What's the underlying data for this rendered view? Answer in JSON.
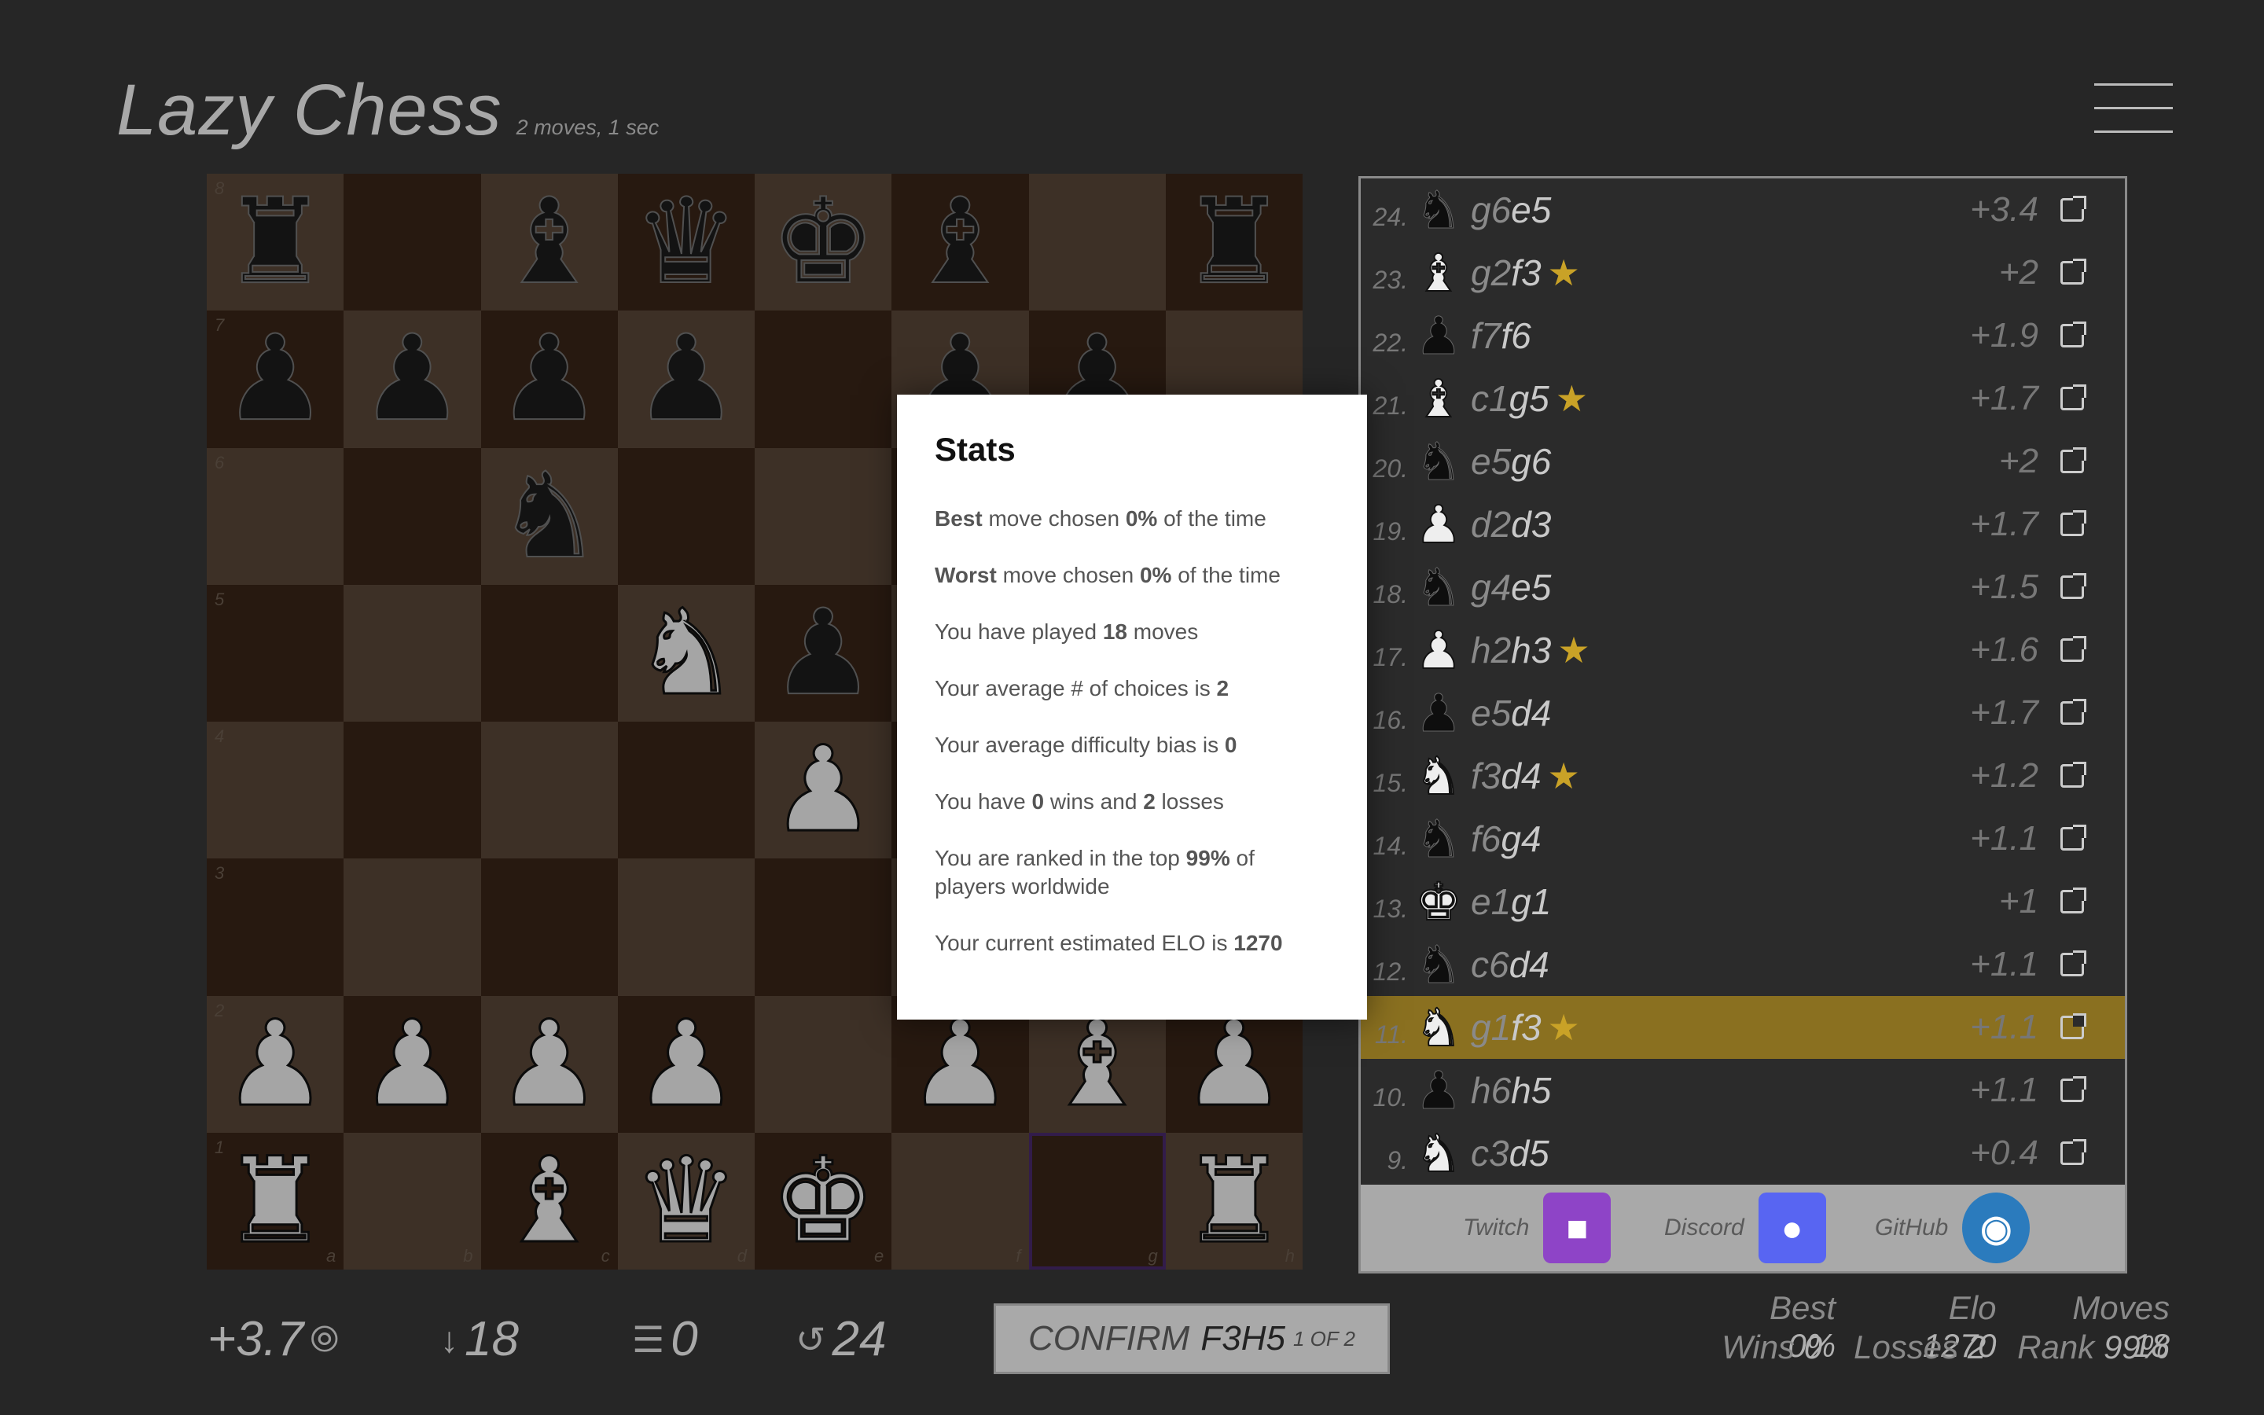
{
  "app": {
    "title": "Lazy Chess",
    "subtitle": "2 moves, 1 sec"
  },
  "menu": {
    "icon": "hamburger-menu-icon"
  },
  "board": {
    "ranks": [
      "8",
      "7",
      "6",
      "5",
      "4",
      "3",
      "2",
      "1"
    ],
    "files": [
      "a",
      "b",
      "c",
      "d",
      "e",
      "f",
      "g",
      "h"
    ],
    "rows": [
      [
        "br",
        "",
        "bb",
        "bq",
        "bk",
        "bb",
        "",
        "br"
      ],
      [
        "bp",
        "bp",
        "bp",
        "bp",
        "",
        "bp",
        "bp",
        ""
      ],
      [
        "",
        "",
        "bn",
        "",
        "",
        "",
        "",
        ""
      ],
      [
        "",
        "",
        "",
        "wn",
        "bp",
        "",
        "",
        ""
      ],
      [
        "",
        "",
        "",
        "",
        "wp",
        "",
        "",
        ""
      ],
      [
        "",
        "",
        "",
        "",
        "",
        "",
        "",
        ""
      ],
      [
        "wp",
        "wp",
        "wp",
        "wp",
        "",
        "wp",
        "wb",
        "wp"
      ],
      [
        "wr",
        "",
        "wb",
        "wq",
        "wk",
        "",
        "",
        "wr"
      ]
    ],
    "selected_square": "g1"
  },
  "move_list": [
    {
      "num": "24.",
      "piece": "bn",
      "from": "g6",
      "to": "e5",
      "star": false,
      "eval": "+3.4"
    },
    {
      "num": "23.",
      "piece": "wb",
      "from": "g2",
      "to": "f3",
      "star": true,
      "eval": "+2"
    },
    {
      "num": "22.",
      "piece": "bp",
      "from": "f7",
      "to": "f6",
      "star": false,
      "eval": "+1.9"
    },
    {
      "num": "21.",
      "piece": "wb",
      "from": "c1",
      "to": "g5",
      "star": true,
      "eval": "+1.7"
    },
    {
      "num": "20.",
      "piece": "bn",
      "from": "e5",
      "to": "g6",
      "star": false,
      "eval": "+2"
    },
    {
      "num": "19.",
      "piece": "wp",
      "from": "d2",
      "to": "d3",
      "star": false,
      "eval": "+1.7"
    },
    {
      "num": "18.",
      "piece": "bn",
      "from": "g4",
      "to": "e5",
      "star": false,
      "eval": "+1.5"
    },
    {
      "num": "17.",
      "piece": "wp",
      "from": "h2",
      "to": "h3",
      "star": true,
      "eval": "+1.6"
    },
    {
      "num": "16.",
      "piece": "bp",
      "from": "e5",
      "to": "d4",
      "star": false,
      "eval": "+1.7"
    },
    {
      "num": "15.",
      "piece": "wn",
      "from": "f3",
      "to": "d4",
      "star": true,
      "eval": "+1.2"
    },
    {
      "num": "14.",
      "piece": "bn",
      "from": "f6",
      "to": "g4",
      "star": false,
      "eval": "+1.1"
    },
    {
      "num": "13.",
      "piece": "wk",
      "from": "e1",
      "to": "g1",
      "star": false,
      "eval": "+1"
    },
    {
      "num": "12.",
      "piece": "bn",
      "from": "c6",
      "to": "d4",
      "star": false,
      "eval": "+1.1"
    },
    {
      "num": "11.",
      "piece": "wn",
      "from": "g1",
      "to": "f3",
      "star": true,
      "eval": "+1.1",
      "highlight": true
    },
    {
      "num": "10.",
      "piece": "bp",
      "from": "h6",
      "to": "h5",
      "star": false,
      "eval": "+1.1"
    },
    {
      "num": "9.",
      "piece": "wn",
      "from": "c3",
      "to": "d5",
      "star": false,
      "eval": "+0.4"
    }
  ],
  "social": {
    "twitch": {
      "label": "Twitch",
      "color": "#8e44c7"
    },
    "discord": {
      "label": "Discord",
      "color": "#5865f2"
    },
    "github": {
      "label": "GitHub",
      "color": "#2b7bbd"
    }
  },
  "bottom": {
    "eval": "+3.7",
    "depth": "18",
    "bias": "0",
    "history": "24",
    "confirm": {
      "label": "CONFIRM",
      "move": "F3H5",
      "count": "1 OF 2"
    }
  },
  "summary": {
    "best_label": "Best",
    "best": "0%",
    "elo_label": "Elo",
    "elo": "1270",
    "moves_label": "Moves",
    "moves": "18",
    "wins_label": "Wins",
    "wins": "0",
    "losses_label": "Losses",
    "losses": "2",
    "rank_label": "Rank",
    "rank": "99%"
  },
  "stats_modal": {
    "title": "Stats",
    "best_pct": "0",
    "worst_pct": "0",
    "moves_played": "18",
    "avg_choices": "2",
    "avg_bias": "0",
    "wins": "0",
    "losses": "2",
    "rank_pct": "99",
    "elo": "1270"
  }
}
